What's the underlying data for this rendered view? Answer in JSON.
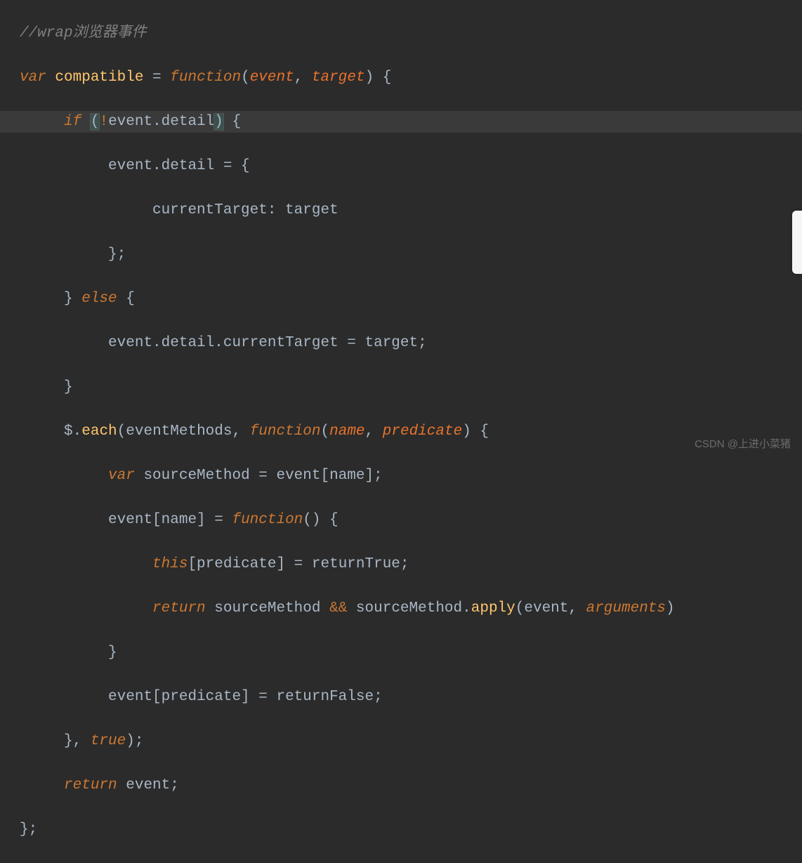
{
  "code": {
    "l1_comment": "//wrap浏览器事件",
    "l2_var": "var",
    "l2_name": "compatible",
    "l2_eq": " = ",
    "l2_func": "function",
    "l2_p1": "event",
    "l2_p2": "target",
    "l3_if": "if",
    "l3_bang": "!",
    "l3_expr": "event.detail",
    "l4_assign": "event.detail = {",
    "l5_key": "currentTarget: target",
    "l6_close": "};",
    "l7_close": "}",
    "l7_else": "else",
    "l7_open": "{",
    "l8_assign": "event.detail.currentTarget = target;",
    "l9_close": "}",
    "l10_dollar": "$.",
    "l10_each": "each",
    "l10_arg1": "(eventMethods, ",
    "l10_func": "function",
    "l10_p1": "name",
    "l10_p2": "predicate",
    "l11_var": "var",
    "l11_rest": " sourceMethod = event[name];",
    "l12_lhs": "event[name] = ",
    "l12_func": "function",
    "l12_rest": "() {",
    "l13_this": "this",
    "l13_rest": "[predicate] = returnTrue;",
    "l14_return": "return",
    "l14_mid1": " sourceMethod ",
    "l14_and": "&&",
    "l14_mid2": " sourceMethod.",
    "l14_apply": "apply",
    "l14_open": "(event, ",
    "l14_args": "arguments",
    "l14_close": ")",
    "l15_close": "}",
    "l16_assign": "event[predicate] = returnFalse;",
    "l17_close": "}, ",
    "l17_true": "true",
    "l17_end": ");",
    "l18_return": "return",
    "l18_rest": " event;",
    "l19_close": "};"
  },
  "watermark": "CSDN @上进小菜猪"
}
